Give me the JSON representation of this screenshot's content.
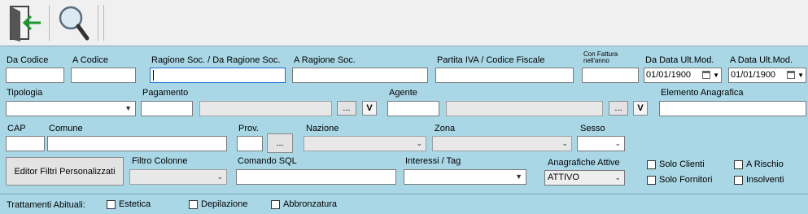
{
  "toolbar": {
    "exit_icon": "exit-door-icon",
    "search_icon": "magnifier-icon"
  },
  "labels": {
    "da_codice": "Da Codice",
    "a_codice": "A Codice",
    "ragione_da": "Ragione Soc. / Da Ragione Soc.",
    "ragione_a": "A Ragione Soc.",
    "partita_iva": "Partita IVA / Codice Fiscale",
    "con_fattura_1": "Con Fattura",
    "con_fattura_2": "nell'anno",
    "da_data": "Da Data Ult.Mod.",
    "a_data": "A Data Ult.Mod.",
    "tipologia": "Tipologia",
    "pagamento": "Pagamento",
    "agente": "Agente",
    "elemento": "Elemento Anagrafica",
    "cap": "CAP",
    "comune": "Comune",
    "prov": "Prov.",
    "nazione": "Nazione",
    "zona": "Zona",
    "sesso": "Sesso",
    "filtro_colonne": "Filtro Colonne",
    "comando_sql": "Comando SQL",
    "interessi": "Interessi / Tag",
    "anagrafiche": "Anagrafiche Attive"
  },
  "values": {
    "da_data": "01/01/1900",
    "a_data": "01/01/1900",
    "anagrafiche": "ATTIVO"
  },
  "buttons": {
    "ellipsis": "...",
    "v": "V",
    "editor": "Editor Filtri Personalizzati"
  },
  "checkboxes": {
    "solo_clienti": "Solo Clienti",
    "solo_fornitori": "Solo Fornitori",
    "a_rischio": "A Rischio",
    "insolventi": "Insolventi"
  },
  "bottom": {
    "title": "Trattamenti Abituali:",
    "items": [
      "Estetica",
      "Depilazione",
      "Abbronzatura"
    ]
  }
}
